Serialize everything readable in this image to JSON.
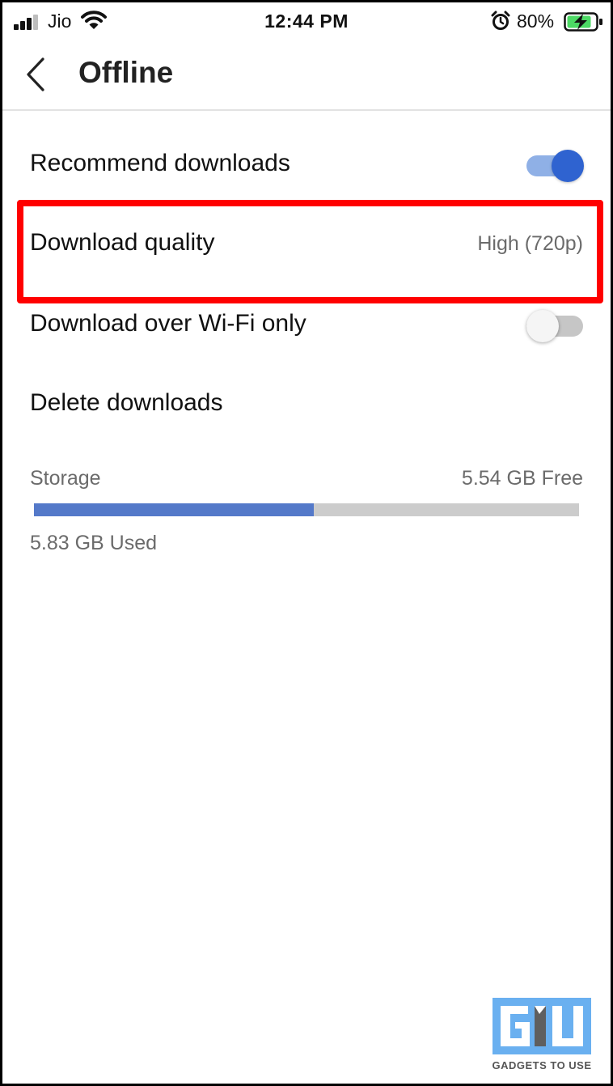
{
  "status_bar": {
    "carrier": "Jio",
    "time": "12:44 PM",
    "battery_percent": "80%"
  },
  "header": {
    "title": "Offline"
  },
  "settings": {
    "recommend_downloads": {
      "label": "Recommend downloads",
      "enabled": true
    },
    "download_quality": {
      "label": "Download quality",
      "value": "High (720p)"
    },
    "wifi_only": {
      "label": "Download over Wi-Fi only",
      "enabled": false
    },
    "delete_downloads": {
      "label": "Delete downloads"
    }
  },
  "storage": {
    "label": "Storage",
    "free": "5.54 GB Free",
    "used": "5.83 GB Used",
    "used_fraction": 0.513
  },
  "watermark": {
    "text": "GADGETS TO USE"
  },
  "colors": {
    "accent": "#2f63d0",
    "highlight": "#ff0000",
    "storage_fill": "#5479c9"
  },
  "icons": {
    "back": "chevron-left-icon",
    "signal": "cellular-signal-icon",
    "wifi": "wifi-icon",
    "alarm": "alarm-clock-icon",
    "battery": "battery-charging-icon"
  }
}
